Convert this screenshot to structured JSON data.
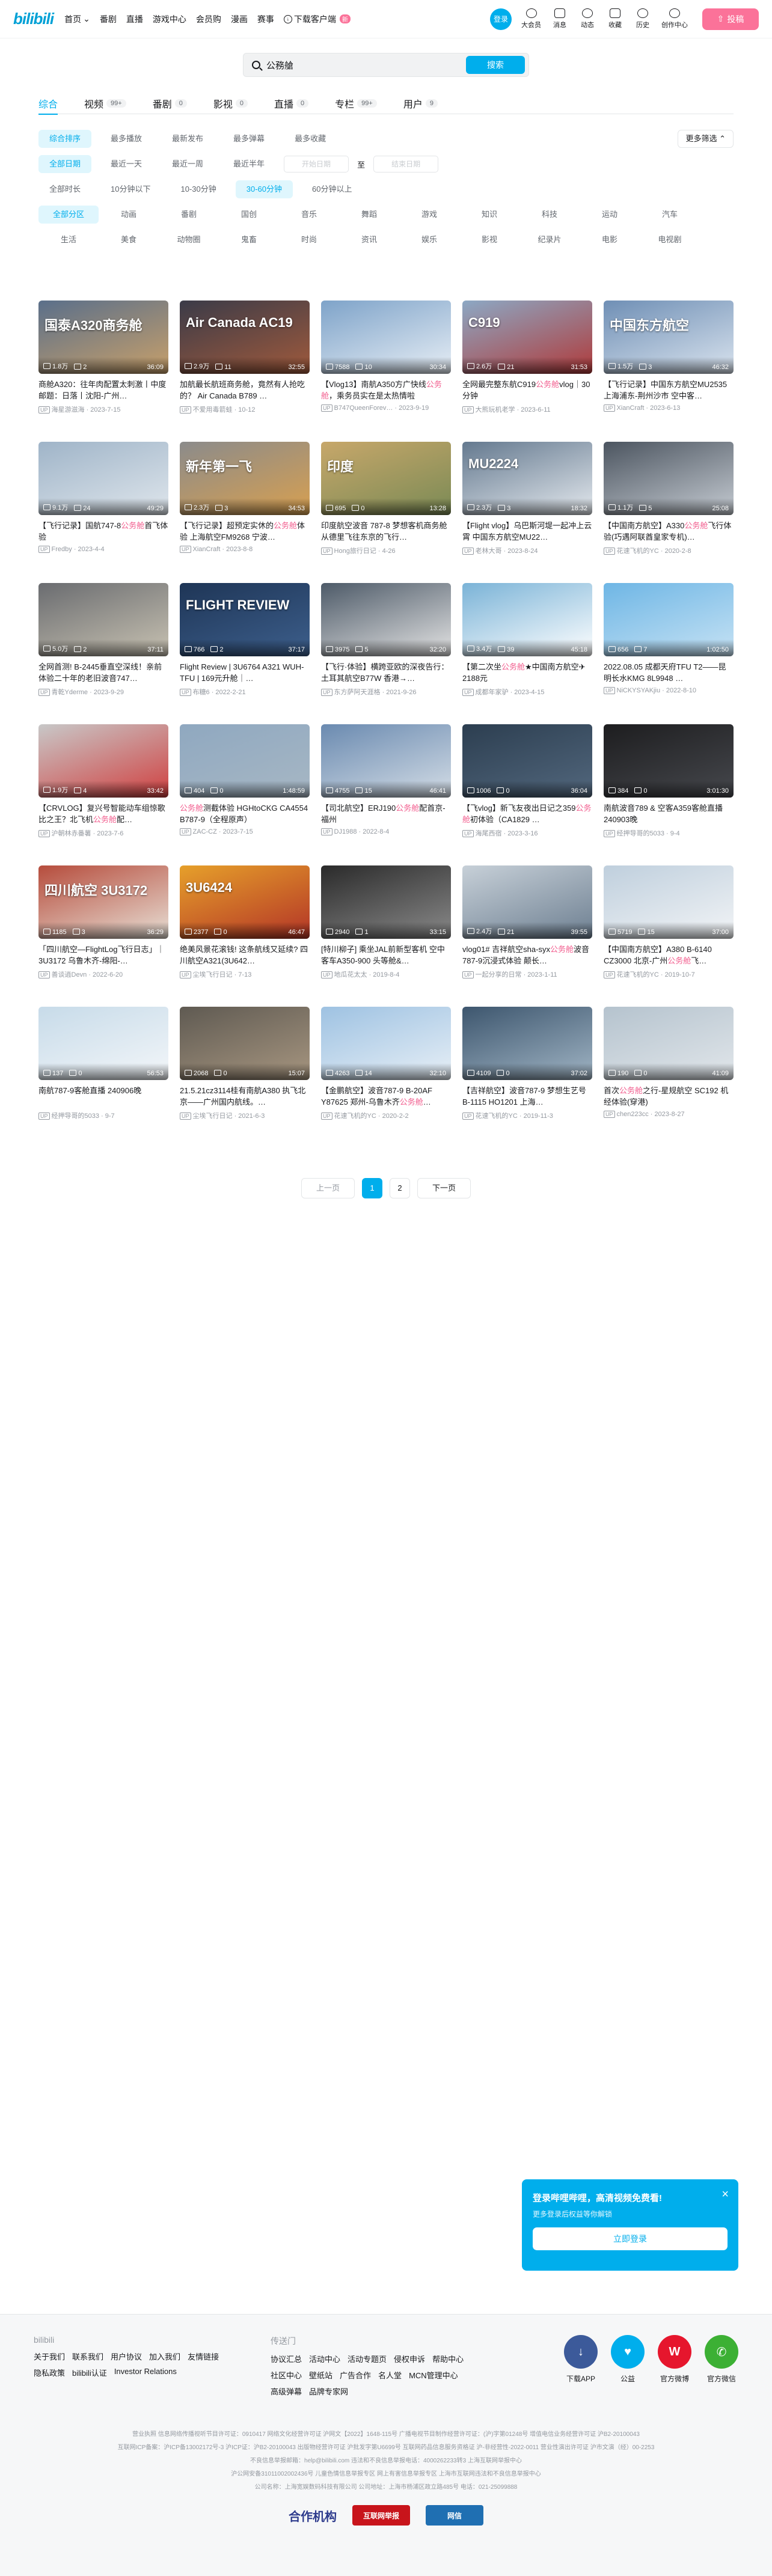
{
  "header": {
    "logo": "bilibili",
    "nav": [
      "首页",
      "番剧",
      "直播",
      "游戏中心",
      "会员购",
      "漫画",
      "赛事"
    ],
    "download": "下载客户端",
    "download_badge": "新",
    "login": "登录",
    "right_items": [
      "大会员",
      "消息",
      "动态",
      "收藏",
      "历史",
      "创作中心"
    ],
    "upload": "投稿"
  },
  "search": {
    "value": "公務艙",
    "button": "搜索"
  },
  "tabs": [
    {
      "label": "综合",
      "count": ""
    },
    {
      "label": "视频",
      "count": "99+"
    },
    {
      "label": "番剧",
      "count": "0"
    },
    {
      "label": "影视",
      "count": "0"
    },
    {
      "label": "直播",
      "count": "0"
    },
    {
      "label": "专栏",
      "count": "99+"
    },
    {
      "label": "用户",
      "count": "9"
    }
  ],
  "filters": {
    "sort": [
      "综合排序",
      "最多播放",
      "最新发布",
      "最多弹幕",
      "最多收藏"
    ],
    "more": "更多筛选",
    "date": [
      "全部日期",
      "最近一天",
      "最近一周",
      "最近半年"
    ],
    "date_start": "开始日期",
    "date_to": "至",
    "date_end": "结束日期",
    "duration": [
      "全部时长",
      "10分钟以下",
      "10-30分钟",
      "30-60分钟",
      "60分钟以上"
    ],
    "zones": [
      "全部分区",
      "动画",
      "番剧",
      "国创",
      "音乐",
      "舞蹈",
      "游戏",
      "知识",
      "科技",
      "运动",
      "汽车",
      "生活",
      "美食",
      "动物圈",
      "鬼畜",
      "时尚",
      "资讯",
      "娱乐",
      "影视",
      "纪录片",
      "电影",
      "电视剧"
    ]
  },
  "videos": [
    {
      "t1": "商舱A320：往年肉配置太刺激丨中度邮题：日落丨沈阳-广州…",
      "hl": "",
      "views": "1.8万",
      "dm": "2",
      "dur": "36:09",
      "author": "海星游滋海",
      "date": "2023-7-15",
      "cap": "国泰A320商务舱",
      "colors": [
        "#5a6f8a",
        "#c8a06a"
      ]
    },
    {
      "t1": "加航最长航班商务舱，竟然有人抢吃的？ Air Canada B789 …",
      "hl": "",
      "views": "2.9万",
      "dm": "11",
      "dur": "32:55",
      "author": "不爱用毒箭蛙",
      "date": "10-12",
      "cap": "Air Canada AC19",
      "colors": [
        "#3b3b48",
        "#a05a3c"
      ]
    },
    {
      "t1": "【Vlog13】南航A350方广快线",
      "hl": "公务舱",
      "t2": "，乘务员实在是太热情啦",
      "views": "7588",
      "dm": "10",
      "dur": "30:34",
      "author": "B747QueenForev…",
      "date": "2023-9-19",
      "cap": "",
      "colors": [
        "#7ea3c9",
        "#e7eef5"
      ]
    },
    {
      "t1": "全网最完整东航C919",
      "hl": "公务舱",
      "t2": "vlog｜30分钟",
      "views": "2.6万",
      "dm": "21",
      "dur": "31:53",
      "author": "大熊玩机老学",
      "date": "2023-6-11",
      "cap": "C919",
      "colors": [
        "#8ca8c4",
        "#b03a3a"
      ]
    },
    {
      "t1": "【飞行记录】中国东方航空MU2535 上海浦东-荆州沙市 空中客…",
      "hl": "",
      "views": "1.5万",
      "dm": "3",
      "dur": "46:32",
      "author": "XianCraft",
      "date": "2023-6-13",
      "cap": "中国东方航空",
      "colors": [
        "#6f8fb5",
        "#d9e3ee"
      ]
    },
    {
      "t1": "【飞行记录】国航747-8",
      "hl": "公务舱",
      "t2": "首飞体验",
      "views": "9.1万",
      "dm": "24",
      "dur": "49:29",
      "author": "Fredby",
      "date": "2023-4-4",
      "cap": "",
      "colors": [
        "#9fb4c8",
        "#dfe6ec"
      ]
    },
    {
      "t1": "【飞行记录】超预定实休的",
      "hl": "公务舱",
      "t2": "体验 上海航空FM9268 宁波…",
      "views": "2.3万",
      "dm": "3",
      "dur": "34:53",
      "author": "XianCraft",
      "date": "2023-8-8",
      "cap": "新年第一飞",
      "colors": [
        "#8b8b8b",
        "#d8a050"
      ]
    },
    {
      "t1": "印度航空波音 787-8 梦想客机商务舱从德里飞往东京的飞行…",
      "hl": "",
      "views": "695",
      "dm": "0",
      "dur": "13:28",
      "author": "Hong旅行日记",
      "date": "4-26",
      "cap": "印度",
      "colors": [
        "#c7a76a",
        "#7a8a55"
      ]
    },
    {
      "t1": "【Flight vlog】乌巴斯河堤一起冲上云霄 中国东方航空MU22…",
      "hl": "",
      "views": "2.3万",
      "dm": "3",
      "dur": "18:32",
      "author": "老林大哥",
      "date": "2023-8-24",
      "cap": "MU2224",
      "colors": [
        "#64798f",
        "#e4e9ee"
      ]
    },
    {
      "t1": "【中国南方航空】A330",
      "hl": "公务舱",
      "t2": "飞行体验(巧遇阿联酋皇家专机)…",
      "views": "1.1万",
      "dm": "5",
      "dur": "25:08",
      "author": "花速飞机的YC",
      "date": "2020-2-8",
      "cap": "",
      "colors": [
        "#4c5560",
        "#c5cbd2"
      ]
    },
    {
      "t1": "全网首测! B-2445垂直空深线！亲前体验二十年的老旧波音747…",
      "hl": "",
      "views": "5.0万",
      "dm": "2",
      "dur": "37:11",
      "author": "青乾Yderme",
      "date": "2023-9-29",
      "cap": "",
      "colors": [
        "#6a6c70",
        "#c8c2b2"
      ]
    },
    {
      "t1": "Flight Review | 3U6764 A321 WUH-TFU | 169元升舱｜…",
      "hl": "",
      "views": "766",
      "dm": "2",
      "dur": "37:17",
      "author": "布糖6",
      "date": "2022-2-21",
      "cap": "FLIGHT REVIEW",
      "colors": [
        "#1e3556",
        "#3d5f8c"
      ]
    },
    {
      "t1": "【飞行·体验】横跨亚欧的深夜告行：土耳其航空B77W 香港→…",
      "hl": "",
      "views": "3975",
      "dm": "5",
      "dur": "32:20",
      "author": "东方萨阿天涯格",
      "date": "2021-9-26",
      "cap": "",
      "colors": [
        "#4d5a68",
        "#e4e4e4"
      ]
    },
    {
      "t1": "【第二次坐",
      "hl": "公务舱",
      "t2": "★中国南方航空✈2188元",
      "views": "3.4万",
      "dm": "39",
      "dur": "45:18",
      "author": "成都年家驴",
      "date": "2023-4-15",
      "cap": "",
      "colors": [
        "#7ab3d7",
        "#ffffff"
      ]
    },
    {
      "t1": "2022.08.05 成都天府TFU T2——昆明长水KMG 8L9948 …",
      "hl": "",
      "views": "656",
      "dm": "7",
      "dur": "1:02:50",
      "author": "NiCKYSYAKjiu",
      "date": "2022-8-10",
      "cap": "",
      "colors": [
        "#6eb6e5",
        "#c6e2f4"
      ]
    },
    {
      "t1": "【CRVLOG】复兴号智能动车组惊歌比之王？北飞机",
      "hl": "公务舱",
      "t2": "配…",
      "views": "1.9万",
      "dm": "4",
      "dur": "33:42",
      "author": "沪朝林赤番薯",
      "date": "2023-7-6",
      "cap": "",
      "colors": [
        "#c8c8c8",
        "#d04040"
      ]
    },
    {
      "t1": "",
      "hl": "公务舱",
      "t2": "测截体验 HGHtoCKG CA4554 B787-9（全程原声）",
      "views": "404",
      "dm": "0",
      "dur": "1:48:59",
      "author": "ZAC-CZ",
      "date": "2023-7-15",
      "cap": "",
      "colors": [
        "#8fa8c0",
        "#a7b7c4"
      ]
    },
    {
      "t1": "【司北航空】ERJ190",
      "hl": "公务舱",
      "t2": "配首京-福州",
      "views": "4755",
      "dm": "15",
      "dur": "46:41",
      "author": "DJ1988",
      "date": "2022-8-4",
      "cap": "",
      "colors": [
        "#6a8ab0",
        "#d4dde6"
      ]
    },
    {
      "t1": "【飞vlog】新飞友夜出日记之359",
      "hl": "公务舱",
      "t2": "初体验（CA1829 …",
      "views": "1006",
      "dm": "0",
      "dur": "36:04",
      "author": "海尾西宿",
      "date": "2023-3-16",
      "cap": "",
      "colors": [
        "#2c3e50",
        "#52677d"
      ]
    },
    {
      "t1": "南航波音789 & 空客A359客舱直播 240903晚",
      "hl": "",
      "views": "384",
      "dm": "0",
      "dur": "3:01:30",
      "author": "经押导哥的5033",
      "date": "9-4",
      "cap": "",
      "colors": [
        "#1d1d1f",
        "#46484d"
      ]
    },
    {
      "t1": "「四川航空—FlightLog飞行日志」｜3U3172 乌鲁木齐-绵阳-…",
      "hl": "",
      "views": "1185",
      "dm": "3",
      "dur": "36:29",
      "author": "善谈逍Devn",
      "date": "2022-6-20",
      "cap": "四川航空 3U3172",
      "colors": [
        "#b64c3c",
        "#e8e0d6"
      ]
    },
    {
      "t1": "绝美风景花滚钱! 这条航线又延续? 四川航空A321(3U642…",
      "hl": "",
      "views": "2377",
      "dm": "0",
      "dur": "46:47",
      "author": "尘埃飞行日记",
      "date": "7-13",
      "cap": "3U6424",
      "colors": [
        "#e6a02a",
        "#b33427"
      ]
    },
    {
      "t1": "[特川柳子] 乘坐JAL前新型客机 空中客车A350-900 头等舱&…",
      "hl": "",
      "views": "2940",
      "dm": "1",
      "dur": "33:15",
      "author": "地瓜花太太",
      "date": "2019-8-4",
      "cap": "",
      "colors": [
        "#2a2a2a",
        "#8a8a8a"
      ]
    },
    {
      "t1": "vlog01# 吉祥航空sha-syx",
      "hl": "公务舱",
      "t2": "波音787-9沉浸式体验 颠长…",
      "views": "2.4万",
      "dm": "21",
      "dur": "39:55",
      "author": "一起分享的日常",
      "date": "2023-1-11",
      "cap": "",
      "colors": [
        "#c7d0d8",
        "#6d7f91"
      ]
    },
    {
      "t1": "【中国南方航空】A380 B-6140 CZ3000 北京-广州",
      "hl": "公务舱",
      "t2": "飞…",
      "views": "5719",
      "dm": "15",
      "dur": "37:00",
      "author": "花速飞机的YC",
      "date": "2019-10-7",
      "cap": "",
      "colors": [
        "#bfcfdd",
        "#f2f4f6"
      ]
    },
    {
      "t1": "南航787-9客舱直播 240906晚",
      "hl": "",
      "views": "137",
      "dm": "0",
      "dur": "56:53",
      "author": "经押导哥的5033",
      "date": "9-7",
      "cap": "",
      "colors": [
        "#c7dbe9",
        "#f3f6f9"
      ]
    },
    {
      "t1": "21.5.21cz3114桂有南航A380 执飞北京——广州国内航线。…",
      "hl": "",
      "views": "2068",
      "dm": "0",
      "dur": "15:07",
      "author": "尘埃飞行日记",
      "date": "2021-6-3",
      "cap": "",
      "colors": [
        "#5f5a52",
        "#a79680"
      ]
    },
    {
      "t1": "【金鹏航空】波音787-9 B-20AF Y87625 郑州-乌鲁木齐",
      "hl": "公务舱",
      "t2": "…",
      "views": "4263",
      "dm": "14",
      "dur": "32:10",
      "author": "花速飞机的YC",
      "date": "2020-2-2",
      "cap": "",
      "colors": [
        "#9ec2e2",
        "#e7eff6"
      ]
    },
    {
      "t1": "【吉祥航空】波音787-9 梦想生艺号 B-1115 HO1201 上海…",
      "hl": "",
      "views": "4109",
      "dm": "0",
      "dur": "37:02",
      "author": "花速飞机的YC",
      "date": "2019-11-3",
      "cap": "",
      "colors": [
        "#3d566e",
        "#a0b4c4"
      ]
    },
    {
      "t1": "首次",
      "hl": "公务舱",
      "t2": "之行-星规航空 SC192 机经体验(穿港)",
      "views": "190",
      "dm": "0",
      "dur": "41:09",
      "author": "chen223cc",
      "date": "2023-8-27",
      "cap": "",
      "colors": [
        "#b5c3ce",
        "#e1e6ea"
      ]
    }
  ],
  "pager": {
    "prev": "上一页",
    "pages": [
      "1",
      "2"
    ],
    "next": "下一页"
  },
  "popup": {
    "title": "登录哔哩哔哩，高清视频免费看!",
    "desc": "更多登录后权益等你解锁",
    "button": "立即登录"
  },
  "footer": {
    "col1_title": "bilibili",
    "col1_links": [
      "关于我们",
      "联系我们",
      "用户协议",
      "加入我们",
      "友情链接",
      "隐私政策",
      "bilibili认证",
      "Investor Relations"
    ],
    "col2_title": "传送门",
    "col2_links": [
      "协议汇总",
      "活动中心",
      "活动专题页",
      "侵权申诉",
      "帮助中心",
      "社区中心",
      "壁纸站",
      "广告合作",
      "名人堂",
      "MCN管理中心",
      "高级弹幕",
      "品牌专家网"
    ],
    "apps": [
      {
        "label": "下载APP",
        "color": "#3c5a9a",
        "glyph": "↓"
      },
      {
        "label": "公益",
        "color": "#00aeec",
        "glyph": "♥"
      },
      {
        "label": "官方微博",
        "color": "#e6162d",
        "glyph": "W"
      },
      {
        "label": "官方微信",
        "color": "#3cb034",
        "glyph": "✆"
      }
    ],
    "legal": [
      "营业执照 信息网络传播视听节目许可证：0910417 网络文化经营许可证 沪网文【2022】1648-115号 广播电视节目制作经营许可证：(沪)字第01248号 增值电信业务经营许可证 沪B2-20100043",
      "互联网ICP备案：沪ICP备13002172号-3 沪ICP证：沪B2-20100043 出版物经营许可证 沪批发字第U6699号 互联网药品信息服务资格证 沪-非经营性-2022-0011 营业性演出许可证 沪市文演（经）00-2253",
      "不良信息举报邮箱：help@bilibili.com 违法和不良信息举报电话：4000262233转3 上海互联网举报中心",
      "沪公网安备31011002002436号 儿童色情信息举报专区 网上有害信息举报专区 上海市互联网违法和不良信息举报中心",
      "公司名称：上海宽娱数码科技有限公司 公司地址：上海市杨浦区政立路485号 电话：021-25099888"
    ],
    "partner_label": "合作机构",
    "partners": [
      {
        "label": "互联网举报",
        "color": "#c8141b"
      },
      {
        "label": "网信",
        "color": "#1f6fb2"
      }
    ]
  },
  "colors": {
    "accent": "#00aeec",
    "pink": "#fb7299",
    "highlight": "#f25d8e"
  }
}
